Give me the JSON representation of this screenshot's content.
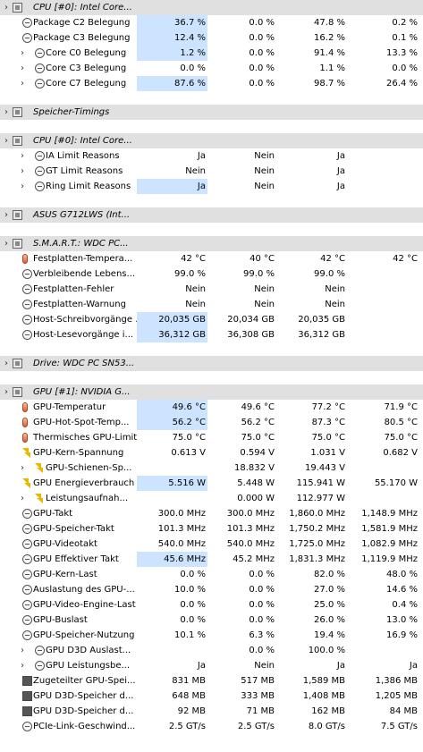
{
  "rows": [
    {
      "t": "group",
      "label": "CPU [#0]: Intel Core..."
    },
    {
      "t": "row",
      "label": "Package C2 Belegung",
      "i": 0,
      "icon": "clock",
      "v": [
        "36.7 %",
        "0.0 %",
        "47.8 %",
        "0.2 %"
      ],
      "hl": true
    },
    {
      "t": "row",
      "label": "Package C3 Belegung",
      "i": 0,
      "icon": "clock",
      "v": [
        "12.4 %",
        "0.0 %",
        "16.2 %",
        "0.1 %"
      ],
      "hl": true
    },
    {
      "t": "row",
      "label": "Core C0 Belegung",
      "i": 1,
      "icon": "clock",
      "v": [
        "1.2 %",
        "0.0 %",
        "91.4 %",
        "13.3 %"
      ],
      "hl": true
    },
    {
      "t": "row",
      "label": "Core C3 Belegung",
      "i": 1,
      "icon": "clock",
      "v": [
        "0.0 %",
        "0.0 %",
        "1.1 %",
        "0.0 %"
      ]
    },
    {
      "t": "row",
      "label": "Core C7 Belegung",
      "i": 1,
      "icon": "clock",
      "v": [
        "87.6 %",
        "0.0 %",
        "98.7 %",
        "26.4 %"
      ],
      "hl": true
    },
    {
      "t": "gap"
    },
    {
      "t": "group",
      "label": "Speicher-Timings"
    },
    {
      "t": "gap"
    },
    {
      "t": "group",
      "label": "CPU [#0]: Intel Core..."
    },
    {
      "t": "row",
      "label": "IA Limit Reasons",
      "i": 1,
      "icon": "clock",
      "v": [
        "Ja",
        "Nein",
        "Ja",
        ""
      ]
    },
    {
      "t": "row",
      "label": "GT Limit Reasons",
      "i": 1,
      "icon": "clock",
      "v": [
        "Nein",
        "Nein",
        "Ja",
        ""
      ]
    },
    {
      "t": "row",
      "label": "Ring Limit Reasons",
      "i": 1,
      "icon": "clock",
      "v": [
        "Ja",
        "Nein",
        "Ja",
        ""
      ],
      "hl": true
    },
    {
      "t": "gap"
    },
    {
      "t": "group",
      "label": "ASUS G712LWS (Int..."
    },
    {
      "t": "gap"
    },
    {
      "t": "group",
      "label": "S.M.A.R.T.: WDC PC..."
    },
    {
      "t": "row",
      "label": "Festplatten-Tempera...",
      "i": 0,
      "icon": "therm",
      "v": [
        "42 °C",
        "40 °C",
        "42 °C",
        "42 °C"
      ]
    },
    {
      "t": "row",
      "label": "Verbleibende Lebens...",
      "i": 0,
      "icon": "clock",
      "v": [
        "99.0 %",
        "99.0 %",
        "99.0 %",
        ""
      ]
    },
    {
      "t": "row",
      "label": "Festplatten-Fehler",
      "i": 0,
      "icon": "clock",
      "v": [
        "Nein",
        "Nein",
        "Nein",
        ""
      ]
    },
    {
      "t": "row",
      "label": "Festplatten-Warnung",
      "i": 0,
      "icon": "clock",
      "v": [
        "Nein",
        "Nein",
        "Nein",
        ""
      ]
    },
    {
      "t": "row",
      "label": "Host-Schreibvorgänge ...",
      "i": 0,
      "icon": "clock",
      "v": [
        "20,035 GB",
        "20,034 GB",
        "20,035 GB",
        ""
      ],
      "hl": true
    },
    {
      "t": "row",
      "label": "Host-Lesevorgänge i...",
      "i": 0,
      "icon": "clock",
      "v": [
        "36,312 GB",
        "36,308 GB",
        "36,312 GB",
        ""
      ],
      "hl": true
    },
    {
      "t": "gap"
    },
    {
      "t": "group",
      "label": "Drive: WDC PC SN53..."
    },
    {
      "t": "gap"
    },
    {
      "t": "group",
      "label": "GPU [#1]: NVIDIA G..."
    },
    {
      "t": "row",
      "label": "GPU-Temperatur",
      "i": 0,
      "icon": "therm",
      "v": [
        "49.6 °C",
        "49.6 °C",
        "77.2 °C",
        "71.9 °C"
      ],
      "hl": true
    },
    {
      "t": "row",
      "label": "GPU-Hot-Spot-Temp...",
      "i": 0,
      "icon": "therm",
      "v": [
        "56.2 °C",
        "56.2 °C",
        "87.3 °C",
        "80.5 °C"
      ],
      "hl": true
    },
    {
      "t": "row",
      "label": "Thermisches GPU-Limit",
      "i": 0,
      "icon": "therm",
      "v": [
        "75.0 °C",
        "75.0 °C",
        "75.0 °C",
        "75.0 °C"
      ]
    },
    {
      "t": "row",
      "label": "GPU-Kern-Spannung",
      "i": 0,
      "icon": "bolt",
      "v": [
        "0.613 V",
        "0.594 V",
        "1.031 V",
        "0.682 V"
      ]
    },
    {
      "t": "row",
      "label": "GPU-Schienen-Sp...",
      "i": 1,
      "icon": "bolt",
      "v": [
        "",
        "18.832 V",
        "19.443 V",
        ""
      ]
    },
    {
      "t": "row",
      "label": "GPU Energieverbrauch",
      "i": 0,
      "icon": "bolt",
      "v": [
        "5.516 W",
        "5.448 W",
        "115.941 W",
        "55.170 W"
      ],
      "hl": true
    },
    {
      "t": "row",
      "label": "Leistungsaufnah...",
      "i": 1,
      "icon": "bolt",
      "v": [
        "",
        "0.000 W",
        "112.977 W",
        ""
      ]
    },
    {
      "t": "row",
      "label": "GPU-Takt",
      "i": 0,
      "icon": "clock",
      "v": [
        "300.0 MHz",
        "300.0 MHz",
        "1,860.0 MHz",
        "1,148.9 MHz"
      ]
    },
    {
      "t": "row",
      "label": "GPU-Speicher-Takt",
      "i": 0,
      "icon": "clock",
      "v": [
        "101.3 MHz",
        "101.3 MHz",
        "1,750.2 MHz",
        "1,581.9 MHz"
      ]
    },
    {
      "t": "row",
      "label": "GPU-Videotakt",
      "i": 0,
      "icon": "clock",
      "v": [
        "540.0 MHz",
        "540.0 MHz",
        "1,725.0 MHz",
        "1,082.9 MHz"
      ]
    },
    {
      "t": "row",
      "label": "GPU Effektiver Takt",
      "i": 0,
      "icon": "clock",
      "v": [
        "45.6 MHz",
        "45.2 MHz",
        "1,831.3 MHz",
        "1,119.9 MHz"
      ],
      "hl": true
    },
    {
      "t": "row",
      "label": "GPU-Kern-Last",
      "i": 0,
      "icon": "clock",
      "v": [
        "0.0 %",
        "0.0 %",
        "82.0 %",
        "48.0 %"
      ]
    },
    {
      "t": "row",
      "label": "Auslastung des GPU-...",
      "i": 0,
      "icon": "clock",
      "v": [
        "10.0 %",
        "0.0 %",
        "27.0 %",
        "14.6 %"
      ]
    },
    {
      "t": "row",
      "label": "GPU-Video-Engine-Last",
      "i": 0,
      "icon": "clock",
      "v": [
        "0.0 %",
        "0.0 %",
        "25.0 %",
        "0.4 %"
      ]
    },
    {
      "t": "row",
      "label": "GPU-Buslast",
      "i": 0,
      "icon": "clock",
      "v": [
        "0.0 %",
        "0.0 %",
        "26.0 %",
        "13.0 %"
      ]
    },
    {
      "t": "row",
      "label": "GPU-Speicher-Nutzung",
      "i": 0,
      "icon": "clock",
      "v": [
        "10.1 %",
        "6.3 %",
        "19.4 %",
        "16.9 %"
      ]
    },
    {
      "t": "row",
      "label": "GPU D3D Auslast...",
      "i": 1,
      "icon": "clock",
      "v": [
        "",
        "0.0 %",
        "100.0 %",
        ""
      ]
    },
    {
      "t": "row",
      "label": "GPU Leistungsbe...",
      "i": 1,
      "icon": "clock",
      "v": [
        "Ja",
        "Nein",
        "Ja",
        "Ja"
      ]
    },
    {
      "t": "row",
      "label": "Zugeteilter GPU-Spei...",
      "i": 0,
      "icon": "disk",
      "v": [
        "831 MB",
        "517 MB",
        "1,589 MB",
        "1,386 MB"
      ]
    },
    {
      "t": "row",
      "label": "GPU D3D-Speicher d...",
      "i": 0,
      "icon": "disk",
      "v": [
        "648 MB",
        "333 MB",
        "1,408 MB",
        "1,205 MB"
      ]
    },
    {
      "t": "row",
      "label": "GPU D3D-Speicher d...",
      "i": 0,
      "icon": "disk",
      "v": [
        "92 MB",
        "71 MB",
        "162 MB",
        "84 MB"
      ]
    },
    {
      "t": "row",
      "label": "PCIe-Link-Geschwind...",
      "i": 0,
      "icon": "clock",
      "v": [
        "2.5 GT/s",
        "2.5 GT/s",
        "8.0 GT/s",
        "7.5 GT/s"
      ]
    }
  ]
}
